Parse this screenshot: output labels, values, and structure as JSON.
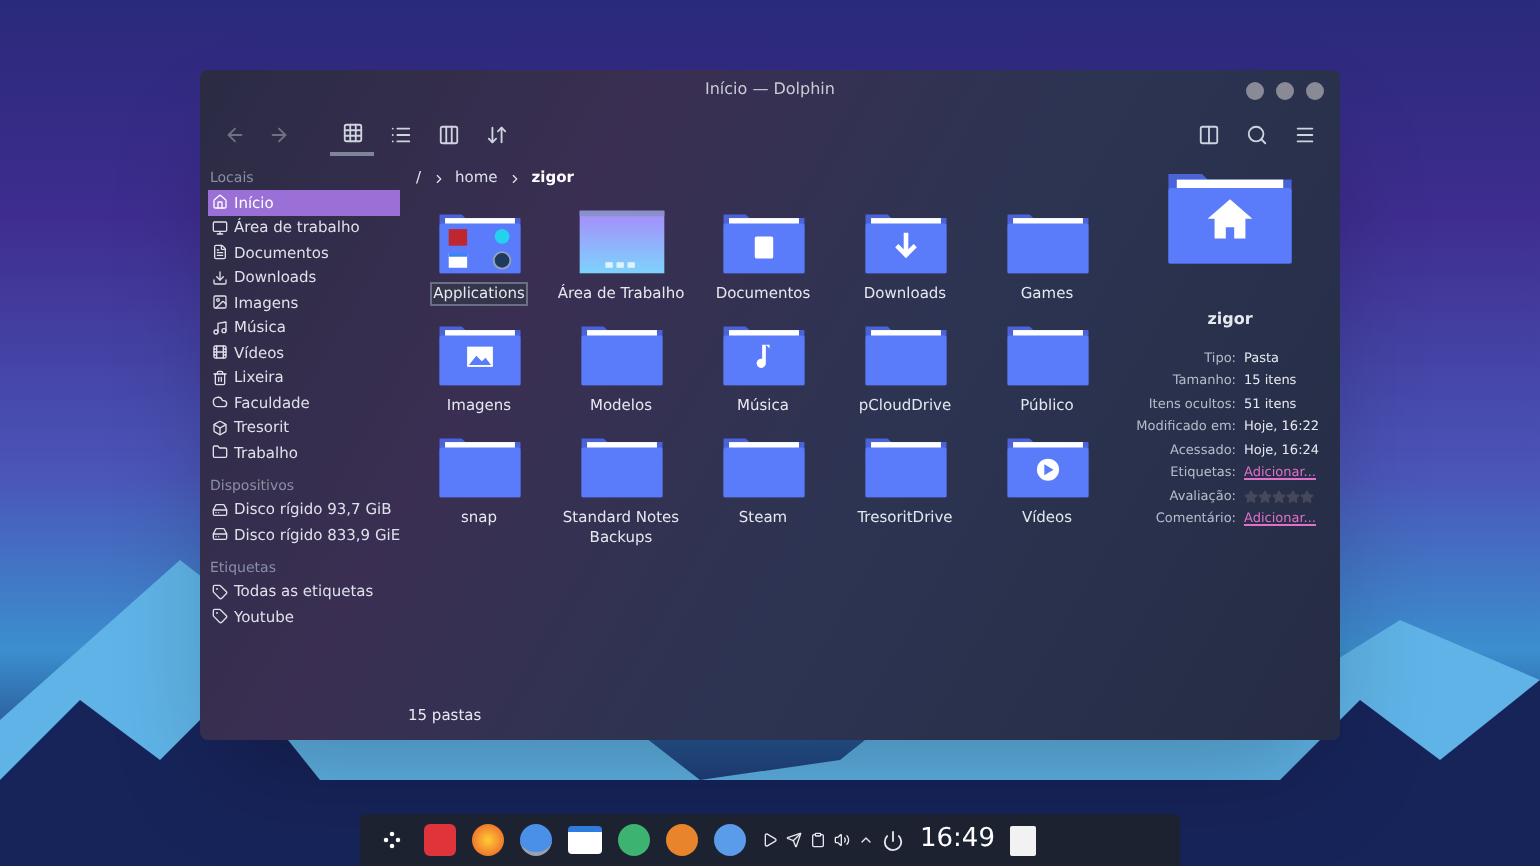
{
  "window": {
    "title": "Início — Dolphin"
  },
  "toolbar": {
    "view_modes": [
      {
        "selected": true
      },
      {
        "selected": false
      },
      {
        "selected": false
      }
    ]
  },
  "breadcrumb": {
    "root": "/",
    "parts": [
      {
        "label": "home",
        "current": false
      },
      {
        "label": "zigor",
        "current": true
      }
    ]
  },
  "sidebar": {
    "sections": [
      {
        "title": "Locais",
        "items": [
          {
            "label": "Início",
            "kind": "home",
            "selected": true
          },
          {
            "label": "Área de trabalho",
            "kind": "desktop",
            "selected": false
          },
          {
            "label": "Documentos",
            "kind": "document",
            "selected": false
          },
          {
            "label": "Downloads",
            "kind": "download",
            "selected": false
          },
          {
            "label": "Imagens",
            "kind": "image",
            "selected": false
          },
          {
            "label": "Música",
            "kind": "music",
            "selected": false
          },
          {
            "label": "Vídeos",
            "kind": "video",
            "selected": false
          },
          {
            "label": "Lixeira",
            "kind": "trash",
            "selected": false
          },
          {
            "label": "Faculdade",
            "kind": "cloud",
            "selected": false
          },
          {
            "label": "Tresorit",
            "kind": "cube",
            "selected": false
          },
          {
            "label": "Trabalho",
            "kind": "folder",
            "selected": false
          }
        ]
      },
      {
        "title": "Dispositivos",
        "items": [
          {
            "label": "Disco rígido 93,7 GiB",
            "kind": "disk",
            "selected": false
          },
          {
            "label": "Disco rígido 833,9 GiE",
            "kind": "disk",
            "selected": false
          }
        ]
      },
      {
        "title": "Etiquetas",
        "items": [
          {
            "label": "Todas as etiquetas",
            "kind": "tag",
            "selected": false
          },
          {
            "label": "Youtube",
            "kind": "tag",
            "selected": false
          }
        ]
      }
    ]
  },
  "files": [
    {
      "name": "Applications",
      "kind": "apps",
      "selected": true
    },
    {
      "name": "Área de Trabalho",
      "kind": "desktop",
      "selected": false
    },
    {
      "name": "Documentos",
      "kind": "document",
      "selected": false
    },
    {
      "name": "Downloads",
      "kind": "download",
      "selected": false
    },
    {
      "name": "Games",
      "kind": "plain",
      "selected": false
    },
    {
      "name": "Imagens",
      "kind": "image",
      "selected": false
    },
    {
      "name": "Modelos",
      "kind": "plain",
      "selected": false
    },
    {
      "name": "Música",
      "kind": "music",
      "selected": false
    },
    {
      "name": "pCloudDrive",
      "kind": "plain",
      "selected": false
    },
    {
      "name": "Público",
      "kind": "plain",
      "selected": false
    },
    {
      "name": "snap",
      "kind": "plain",
      "selected": false
    },
    {
      "name": "Standard Notes Backups",
      "kind": "plain",
      "selected": false
    },
    {
      "name": "Steam",
      "kind": "plain",
      "selected": false
    },
    {
      "name": "TresoritDrive",
      "kind": "plain",
      "selected": false
    },
    {
      "name": "Vídeos",
      "kind": "video",
      "selected": false
    }
  ],
  "info_panel": {
    "name": "zigor",
    "fields": [
      {
        "label": "Tipo:",
        "kind": "text",
        "value": "Pasta"
      },
      {
        "label": "Tamanho:",
        "kind": "text",
        "value": "15 itens"
      },
      {
        "label": "Itens ocultos:",
        "kind": "text",
        "value": "51 itens"
      },
      {
        "label": "Modificado em:",
        "kind": "text",
        "value": "Hoje, 16:22"
      },
      {
        "label": "Acessado:",
        "kind": "text",
        "value": "Hoje, 16:24"
      },
      {
        "label": "Etiquetas:",
        "kind": "link",
        "value": "Adicionar..."
      },
      {
        "label": "Avaliação:",
        "kind": "stars",
        "stars": 0
      },
      {
        "label": "Comentário:",
        "kind": "link",
        "value": "Adicionar..."
      }
    ]
  },
  "status_bar": {
    "text": "15 pastas"
  },
  "taskbar": {
    "clock": "16:49"
  }
}
